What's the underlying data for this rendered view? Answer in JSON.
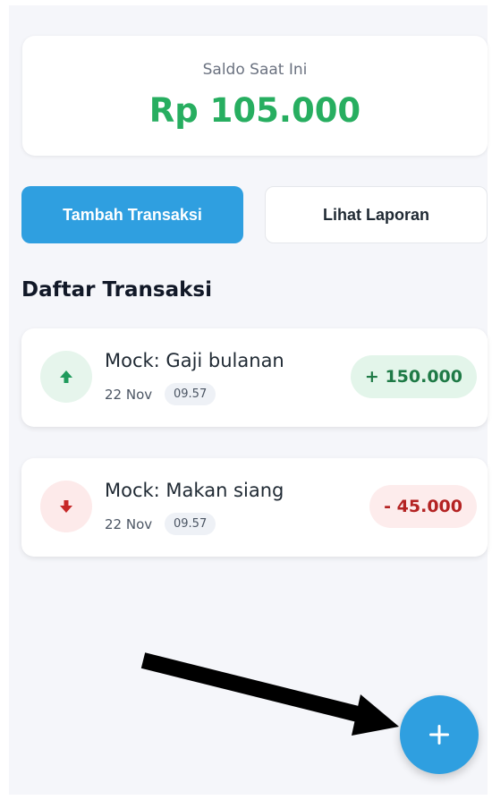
{
  "balance": {
    "label": "Saldo Saat Ini",
    "value": "Rp 105.000",
    "color": "#27ae60"
  },
  "actions": {
    "add_label": "Tambah Transaksi",
    "report_label": "Lihat Laporan"
  },
  "transactions_title": "Daftar Transaksi",
  "transactions": [
    {
      "type": "income",
      "icon": "arrow-up-icon",
      "title": "Mock: Gaji bulanan",
      "date": "22 Nov",
      "time": "09.57",
      "amount": "+ 150.000"
    },
    {
      "type": "expense",
      "icon": "arrow-down-icon",
      "title": "Mock: Makan siang",
      "date": "22 Nov",
      "time": "09.57",
      "amount": "- 45.000"
    }
  ],
  "fab": {
    "icon": "plus-icon"
  },
  "colors": {
    "primary": "#2f9fe0",
    "income": "#1e7a46",
    "expense": "#b42323"
  }
}
